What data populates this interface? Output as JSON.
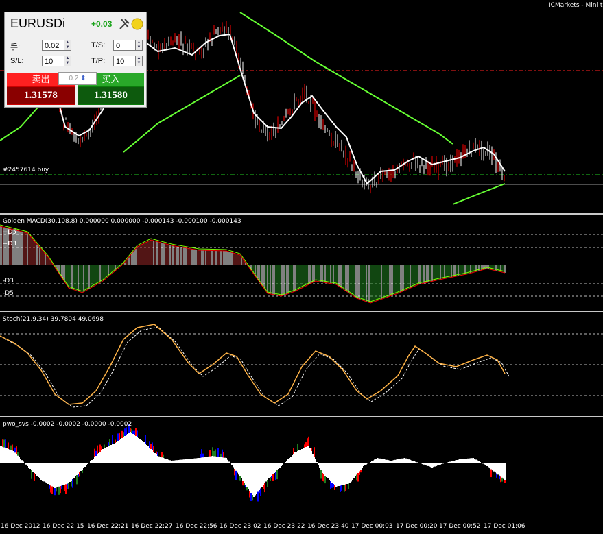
{
  "window": {
    "title_fragment": "ICMarkets - Mini te"
  },
  "trade_panel": {
    "symbol": "EURUSDi",
    "profit": "+0.03",
    "lots_label": "手:",
    "lots_value": "0.02",
    "ts_label": "T/S:",
    "ts_value": "0",
    "sl_label": "S/L:",
    "sl_value": "10",
    "tp_label": "T/P:",
    "tp_value": "10",
    "sell_label": "卖出",
    "buy_label": "买入",
    "sell_price": "1.31578",
    "buy_price": "1.31580",
    "lot_step": "0.2"
  },
  "order_line": {
    "label": "#2457614 buy"
  },
  "indicators": {
    "macd": {
      "title": "Golden MACD(30,108,8) 0.000000 0.000000 -0.000143 -0.000100 -0.000143",
      "levels": [
        "+D5",
        "+D3",
        "-D3",
        "-D5"
      ]
    },
    "stoch": {
      "title": "Stoch(21,9,34) 39.7804 49.0698"
    },
    "pwo": {
      "title": "pwo_svs -0.0002 -0.0002 -0.0000 -0.0002"
    }
  },
  "time_axis": [
    "16 Dec 2012",
    "16 Dec 22:15",
    "16 Dec 22:21",
    "16 Dec 22:27",
    "16 Dec 22:56",
    "16 Dec 23:02",
    "16 Dec 23:22",
    "16 Dec 23:40",
    "17 Dec 00:03",
    "17 Dec 00:20",
    "17 Dec 00:52",
    "17 Dec 01:06"
  ],
  "colors": {
    "bull": "#ffffff",
    "bear": "#ff0000",
    "ma_white": "#ffffff",
    "ma_green": "#66ff33",
    "macd_pos": "#a52a2a",
    "macd_neg": "#228b22",
    "stoch_main": "#ffb347",
    "pwo_red": "#ff0000",
    "pwo_blue": "#0000ff",
    "pwo_green": "#1e7d1e"
  }
}
